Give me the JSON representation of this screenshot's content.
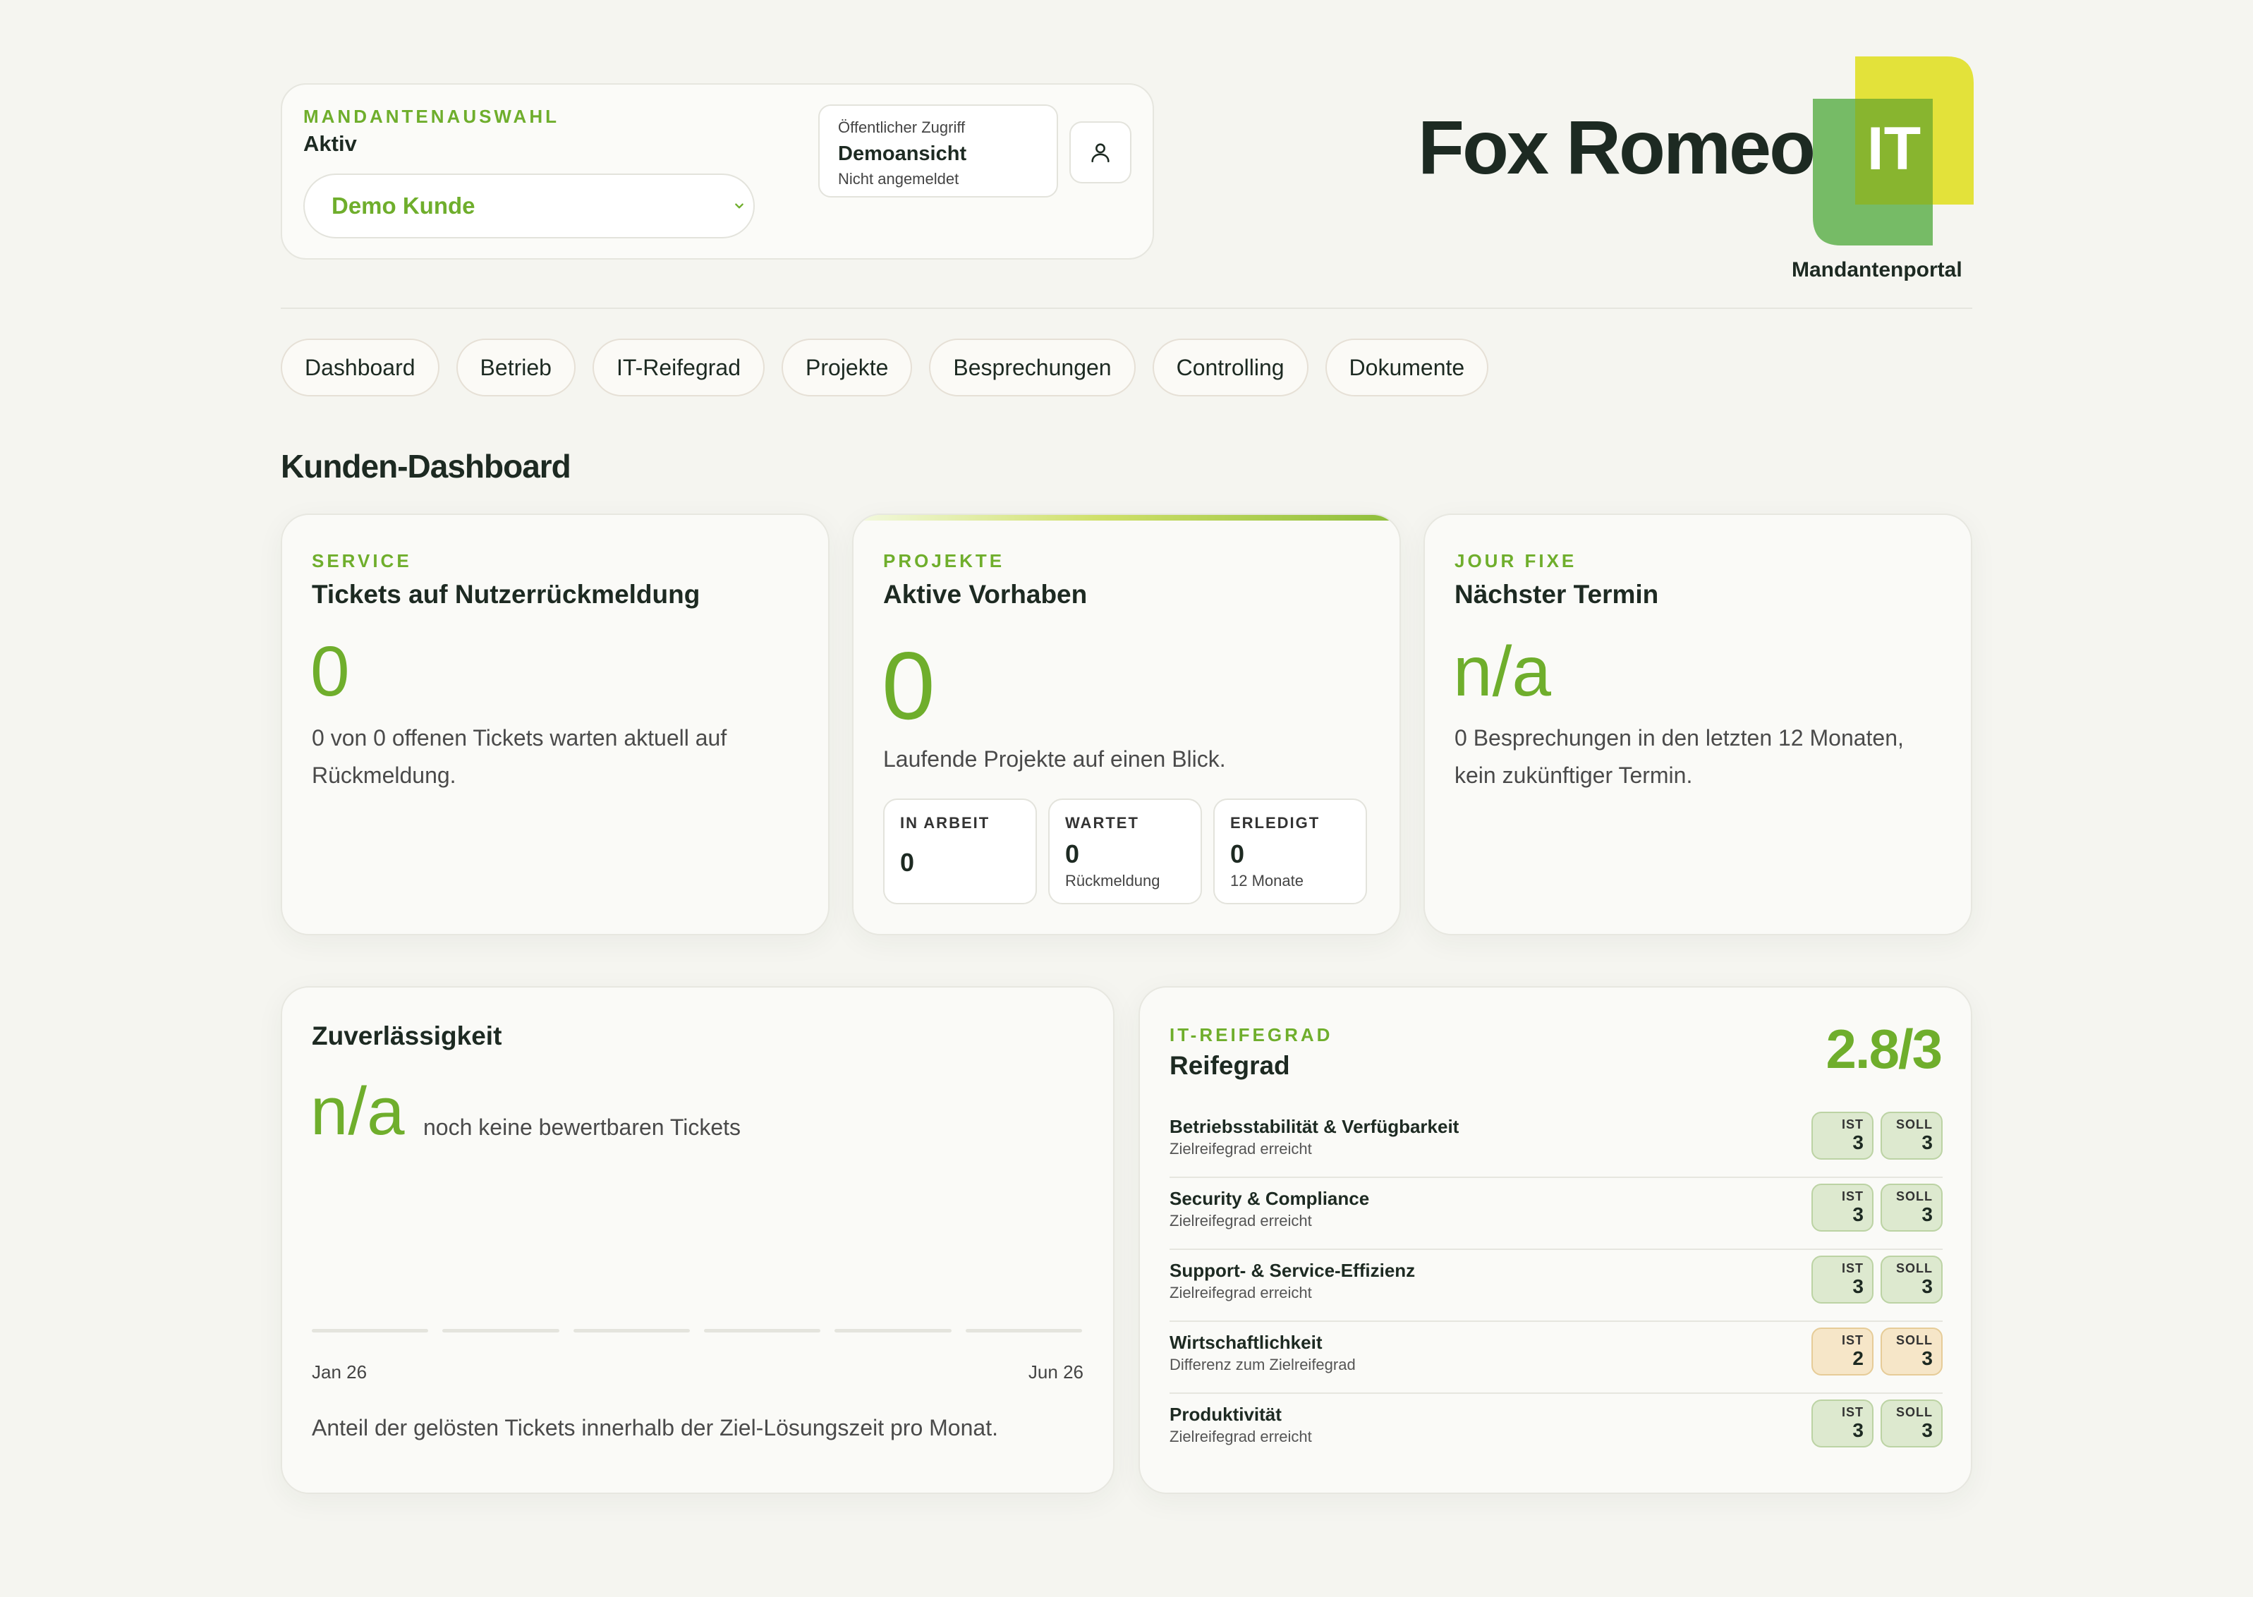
{
  "tenant_selector": {
    "eyebrow": "MANDANTENAUSWAHL",
    "status": "Aktiv",
    "selected_client": "Demo Kunde",
    "access": {
      "line1": "Öffentlicher Zugriff",
      "line2": "Demoansicht",
      "line3": "Nicht angemeldet"
    }
  },
  "brand": {
    "title": "Fox Romeo",
    "logo_text": "IT",
    "subtitle": "Mandantenportal"
  },
  "nav": [
    "Dashboard",
    "Betrieb",
    "IT-Reifegrad",
    "Projekte",
    "Besprechungen",
    "Controlling",
    "Dokumente"
  ],
  "page_title": "Kunden-Dashboard",
  "service_card": {
    "eyebrow": "SERVICE",
    "title": "Tickets auf Nutzerrückmeldung",
    "value": "0",
    "text_line1": "0 von 0 offenen Tickets warten aktuell auf",
    "text_line2": "Rückmeldung."
  },
  "projects_card": {
    "eyebrow": "PROJEKTE",
    "title": "Aktive Vorhaben",
    "value": "0",
    "text": "Laufende Projekte auf einen Blick.",
    "stats": [
      {
        "label": "IN ARBEIT",
        "value": "0",
        "sub": ""
      },
      {
        "label": "WARTET",
        "value": "0",
        "sub": "Rückmeldung"
      },
      {
        "label": "ERLEDIGT",
        "value": "0",
        "sub": "12 Monate"
      }
    ]
  },
  "jour_fixe_card": {
    "eyebrow": "JOUR FIXE",
    "title": "Nächster Termin",
    "value": "n/a",
    "text_line1": "0 Besprechungen in den letzten 12 Monaten,",
    "text_line2": "kein zukünftiger Termin."
  },
  "reliability_card": {
    "title": "Zuverlässigkeit",
    "value": "n/a",
    "value_note": "noch keine bewertbaren Tickets",
    "axis_start": "Jan 26",
    "axis_end": "Jun 26",
    "footer": "Anteil der gelösten Tickets innerhalb der Ziel-Lösungszeit pro Monat."
  },
  "maturity_card": {
    "eyebrow": "IT-REIFEGRAD",
    "title": "Reifegrad",
    "score": "2.8/3",
    "ist_label": "IST",
    "soll_label": "SOLL",
    "rows": [
      {
        "name": "Betriebsstabilität & Verfügbarkeit",
        "status": "Zielreifegrad erreicht",
        "ist": "3",
        "soll": "3",
        "state": "ok"
      },
      {
        "name": "Security & Compliance",
        "status": "Zielreifegrad erreicht",
        "ist": "3",
        "soll": "3",
        "state": "ok"
      },
      {
        "name": "Support- & Service-Effizienz",
        "status": "Zielreifegrad erreicht",
        "ist": "3",
        "soll": "3",
        "state": "ok"
      },
      {
        "name": "Wirtschaftlichkeit",
        "status": "Differenz zum Zielreifegrad",
        "ist": "2",
        "soll": "3",
        "state": "warn"
      },
      {
        "name": "Produktivität",
        "status": "Zielreifegrad erreicht",
        "ist": "3",
        "soll": "3",
        "state": "ok"
      }
    ]
  },
  "colors": {
    "accent": "#6fae2c",
    "background": "#f5f5f0",
    "badge_ok": "#dde9cf",
    "badge_warn": "#f6e6c8"
  }
}
